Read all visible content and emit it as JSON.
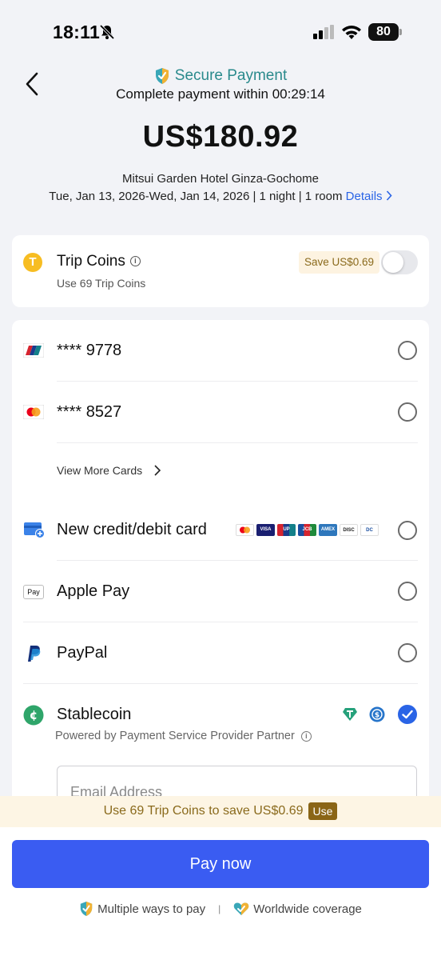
{
  "status_bar": {
    "time": "18:11",
    "battery": "80"
  },
  "header": {
    "secure_label": "Secure Payment",
    "complete_prefix": "Complete payment within",
    "countdown": "00:29:14",
    "amount": "US$180.92",
    "hotel": "Mitsui Garden Hotel Ginza-Gochome",
    "stay": "Tue, Jan 13, 2026-Wed, Jan 14, 2026 | 1 night | 1 room",
    "details_label": "Details"
  },
  "trip_coins": {
    "title": "Trip Coins",
    "sub": "Use 69 Trip Coins",
    "save": "Save US$0.69",
    "enabled": false
  },
  "methods": {
    "card1": "**** 9778",
    "card2": "**** 8527",
    "view_more": "View More Cards",
    "new_card": "New credit/debit card",
    "apple_pay": "Apple Pay",
    "apple_pay_icon": "Pay",
    "paypal": "PayPal",
    "stablecoin": "Stablecoin",
    "stablecoin_selected": true,
    "powered_by": "Powered by Payment Service Provider Partner",
    "email_placeholder": "Email Address"
  },
  "card_brands": [
    "mastercard",
    "visa",
    "unionpay",
    "jcb",
    "amex",
    "discover",
    "diners"
  ],
  "promo": {
    "text": "Use 69 Trip Coins to save US$0.69",
    "use_label": "Use"
  },
  "footer": {
    "pay_label": "Pay now",
    "feature1": "Multiple ways to pay",
    "feature2": "Worldwide coverage"
  },
  "colors": {
    "accent_blue": "#3a5cf2",
    "link_blue": "#2a64e6",
    "secure_teal": "#2a8a8c",
    "promo_gold": "#8a6a1c",
    "promo_bg": "#fdf5e4"
  }
}
